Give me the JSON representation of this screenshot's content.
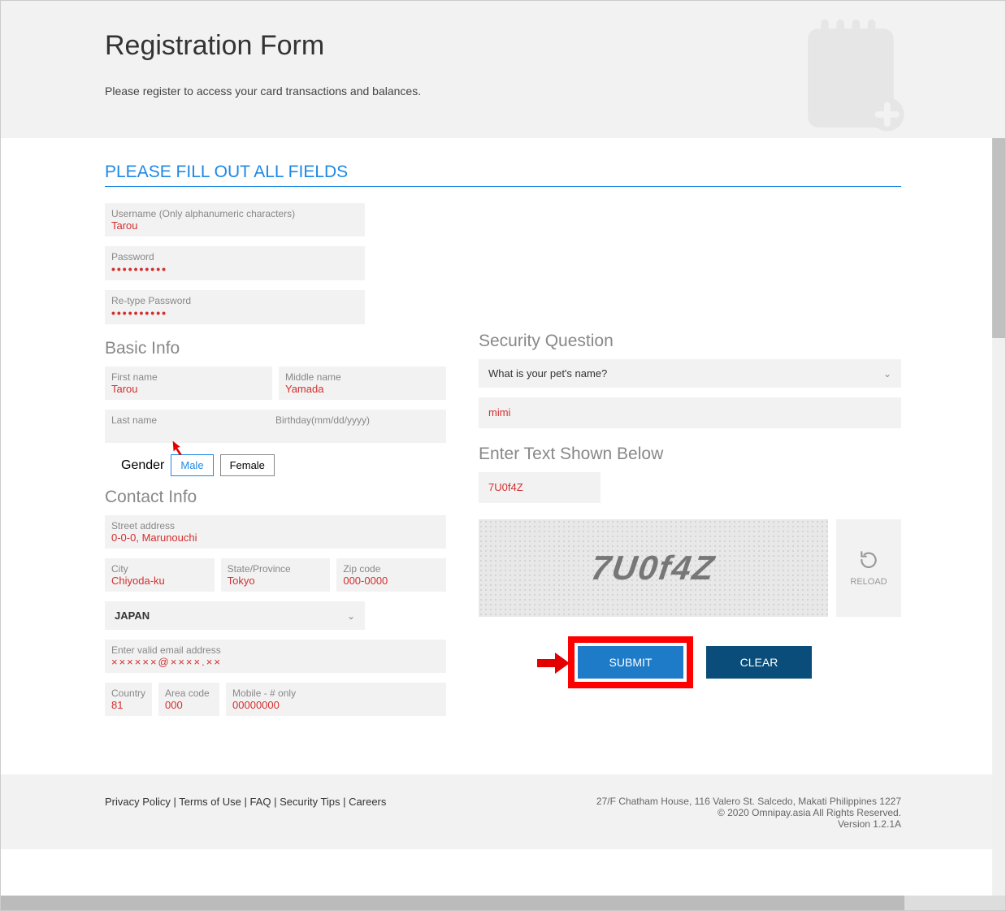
{
  "header": {
    "title": "Registration Form",
    "subtitle": "Please register to access your card transactions and balances."
  },
  "section_title": "PLEASE FILL OUT ALL FIELDS",
  "credentials": {
    "username_label": "Username (Only alphanumeric characters)",
    "username_value": "Tarou",
    "password_label": "Password",
    "password_mask": "••••••••••",
    "retype_label": "Re-type Password",
    "retype_mask": "••••••••••"
  },
  "basic_info_heading": "Basic Info",
  "basic": {
    "first_label": "First name",
    "first_value": "Tarou",
    "middle_label": "Middle name",
    "middle_value": "Yamada",
    "last_label": "Last name",
    "birthday_label": "Birthday(mm/dd/yyyy)"
  },
  "gender": {
    "label": "Gender",
    "male": "Male",
    "female": "Female"
  },
  "contact_heading": "Contact Info",
  "contact": {
    "street_label": "Street address",
    "street_value": "0-0-0, Marunouchi",
    "city_label": "City",
    "city_value": "Chiyoda-ku",
    "state_label": "State/Province",
    "state_value": "Tokyo",
    "zip_label": "Zip code",
    "zip_value": "000-0000",
    "country_selected": "JAPAN",
    "email_label": "Enter valid email address",
    "email_value": "××××××@××××.××",
    "phone_country_label": "Country",
    "phone_country_value": "81",
    "area_label": "Area code",
    "area_value": "000",
    "mobile_label": "Mobile - # only",
    "mobile_value": "00000000"
  },
  "security": {
    "heading": "Security Question",
    "question": "What is your pet's name?",
    "answer": "mimi"
  },
  "captcha": {
    "heading": "Enter Text Shown Below",
    "input_value": "7U0f4Z",
    "image_text": "7U0f4Z",
    "reload": "RELOAD"
  },
  "buttons": {
    "submit": "SUBMIT",
    "clear": "CLEAR"
  },
  "footer": {
    "privacy": "Privacy Policy",
    "terms": "Terms of Use",
    "faq": "FAQ",
    "security": "Security Tips",
    "careers": "Careers",
    "address": "27/F Chatham House, 116 Valero St. Salcedo, Makati Philippines 1227",
    "copyright": "© 2020 Omnipay.asia All Rights Reserved.",
    "version": "Version 1.2.1A"
  }
}
